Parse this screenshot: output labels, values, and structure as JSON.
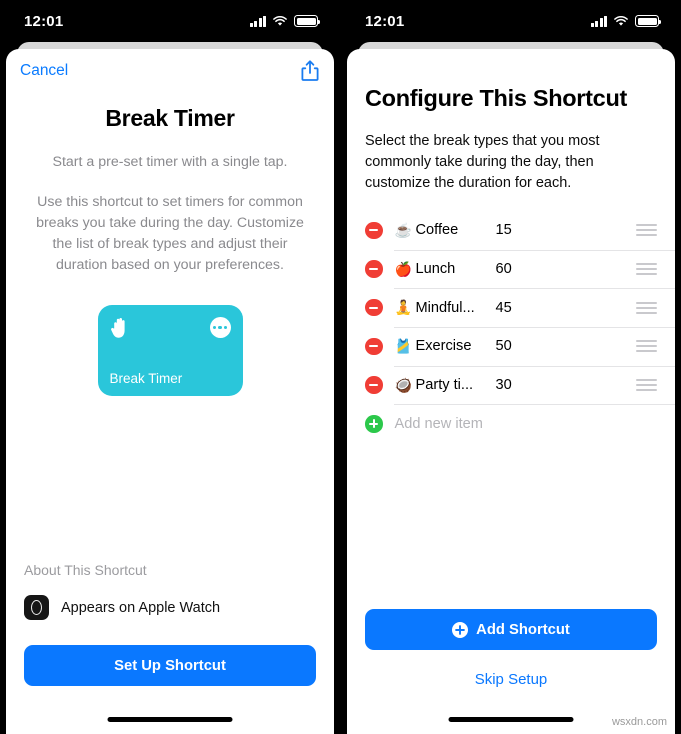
{
  "status_bar": {
    "time": "12:01",
    "signal_icon": "cellular-bars-icon",
    "wifi_icon": "wifi-icon",
    "battery_icon": "battery-icon"
  },
  "left_screen": {
    "nav": {
      "cancel_label": "Cancel",
      "share_icon": "share-icon"
    },
    "title": "Break Timer",
    "subtitle": "Start a pre-set timer with a single tap.",
    "description": "Use this shortcut to set timers for common breaks you take during the day. Customize the list of break types and adjust their duration based on your preferences.",
    "card": {
      "label": "Break Timer",
      "color": "#2ac6da",
      "glyph_icon": "raised-hand-icon",
      "menu_icon": "more-dots-icon"
    },
    "about": {
      "heading": "About This Shortcut",
      "item_icon": "apple-watch-icon",
      "item_label": "Appears on Apple Watch"
    },
    "primary_button": "Set Up Shortcut"
  },
  "right_screen": {
    "title": "Configure This Shortcut",
    "description": "Select the break types that you most commonly take during the day, then customize the duration for each.",
    "list": [
      {
        "emoji": "☕",
        "emoji_name": "coffee-emoji",
        "label": "Coffee",
        "value": "15"
      },
      {
        "emoji": "🍎",
        "emoji_name": "apple-emoji",
        "label": "Lunch",
        "value": "60"
      },
      {
        "emoji": "🧘",
        "emoji_name": "meditation-emoji",
        "label": "Mindful...",
        "value": "45"
      },
      {
        "emoji": "🎽",
        "emoji_name": "running-shirt-emoji",
        "label": "Exercise",
        "value": "50"
      },
      {
        "emoji": "🥥",
        "emoji_name": "coconut-emoji",
        "label": "Party ti...",
        "value": "30"
      }
    ],
    "add_new_label": "Add new item",
    "primary_button": "Add Shortcut",
    "skip_button": "Skip Setup"
  },
  "watermark": "wsxdn.com",
  "colors": {
    "accent_blue": "#0a78ff",
    "card_teal": "#2ac6da",
    "delete_red": "#f03d35",
    "add_green": "#2cc84b"
  }
}
